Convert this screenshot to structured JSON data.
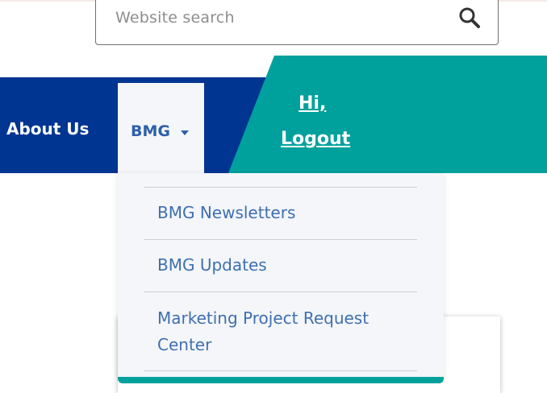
{
  "search": {
    "placeholder": "Website search"
  },
  "nav": {
    "about_label": "About Us",
    "bmg_label": "BMG"
  },
  "user": {
    "greeting": "Hi,",
    "logout_label": "Logout"
  },
  "dropdown": {
    "items": [
      {
        "label": "BMG Newsletters"
      },
      {
        "label": "BMG Updates"
      },
      {
        "label": "Marketing Project Request Center"
      }
    ]
  },
  "colors": {
    "nav_blue": "#003591",
    "teal": "#00a19d",
    "link_blue": "#3f6fb0",
    "dropdown_bg": "#f4f6fa"
  },
  "icons": {
    "search": "search-icon",
    "caret": "caret-down-icon"
  }
}
